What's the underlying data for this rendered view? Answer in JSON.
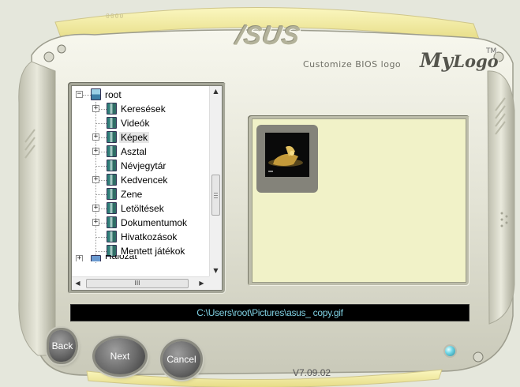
{
  "brand": {
    "logo_text": "/SUS"
  },
  "header": {
    "customize_label": "Customize BIOS logo",
    "product_name_my": "My",
    "product_name_logo": "Logo",
    "trademark": "TM",
    "top_decoration": "0000"
  },
  "tree": {
    "root_label": "root",
    "items": [
      {
        "label": "Keresések",
        "expandable": true
      },
      {
        "label": "Videók",
        "expandable": false
      },
      {
        "label": "Képek",
        "expandable": true,
        "selected": true
      },
      {
        "label": "Asztal",
        "expandable": true
      },
      {
        "label": "Névjegytár",
        "expandable": false
      },
      {
        "label": "Kedvencek",
        "expandable": true
      },
      {
        "label": "Zene",
        "expandable": false
      },
      {
        "label": "Letöltések",
        "expandable": true
      },
      {
        "label": "Dokumentumok",
        "expandable": true
      },
      {
        "label": "Hivatkozások",
        "expandable": false
      },
      {
        "label": "Mentett játékok",
        "expandable": false
      }
    ],
    "partial_next_label": "Hálózat",
    "hscroll_thumb_glyph": "III"
  },
  "preview": {
    "thumbnail_count": 1
  },
  "path_bar": {
    "path": "C:\\Users\\root\\Pictures\\asus_ copy.gif"
  },
  "buttons": {
    "back": "Back",
    "next": "Next",
    "cancel": "Cancel"
  },
  "footer": {
    "version": "V7.09.02"
  },
  "colors": {
    "body_bg": "#e5e7dc",
    "path_text": "#7fd0e2",
    "preview_bg": "#f1f2c8",
    "led": "#6fd6e6"
  }
}
